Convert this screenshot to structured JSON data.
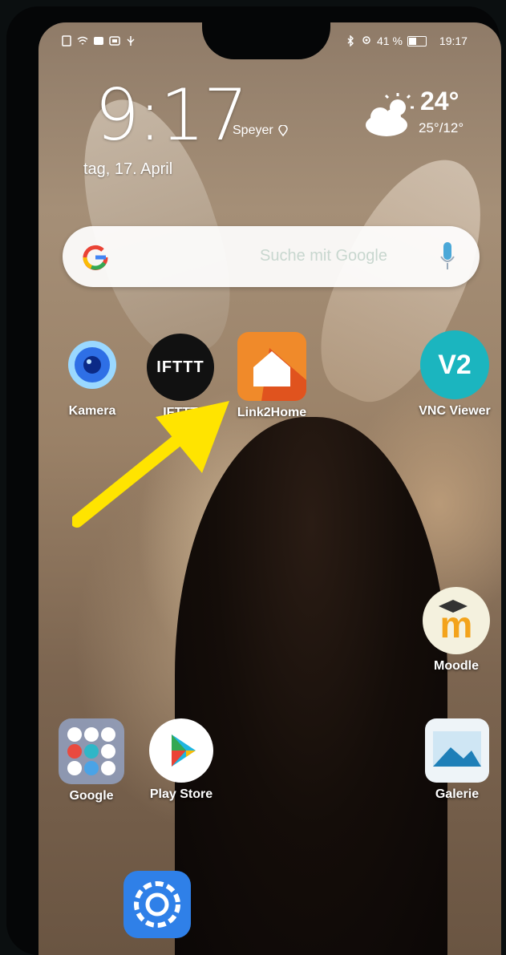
{
  "status_bar": {
    "left_icons": [
      "sim-icon",
      "wifi-icon",
      "notification-icon",
      "notification-icon",
      "usb-icon"
    ],
    "battery_percent": "41 %",
    "time": "19:17"
  },
  "clock_widget": {
    "time": "9:17",
    "date": "tag, 17. April",
    "location": "Speyer"
  },
  "weather": {
    "temp": "24°",
    "range": "25°/12°"
  },
  "search": {
    "placeholder": "Suche mit Google"
  },
  "apps": [
    {
      "name": "Kamera",
      "icon": "camera-icon"
    },
    {
      "name": "IFTTT",
      "icon": "ifttt-icon",
      "icon_text": "IFTTT"
    },
    {
      "name": "Link2Home",
      "icon": "home-icon"
    },
    {
      "name": "VNC Viewer",
      "icon": "vnc-icon",
      "icon_text": "V2"
    },
    {
      "name": "Moodle",
      "icon": "moodle-icon",
      "icon_text": "m"
    },
    {
      "name": "Google",
      "icon": "folder-icon"
    },
    {
      "name": "Play Store",
      "icon": "play-store-icon"
    },
    {
      "name": "Galerie",
      "icon": "gallery-icon"
    },
    {
      "name": "",
      "icon": "settings-icon"
    }
  ],
  "colors": {
    "arrow": "#ffe400",
    "link2home_orange": "#f08a2a",
    "vnc_teal": "#1bb5bf"
  }
}
